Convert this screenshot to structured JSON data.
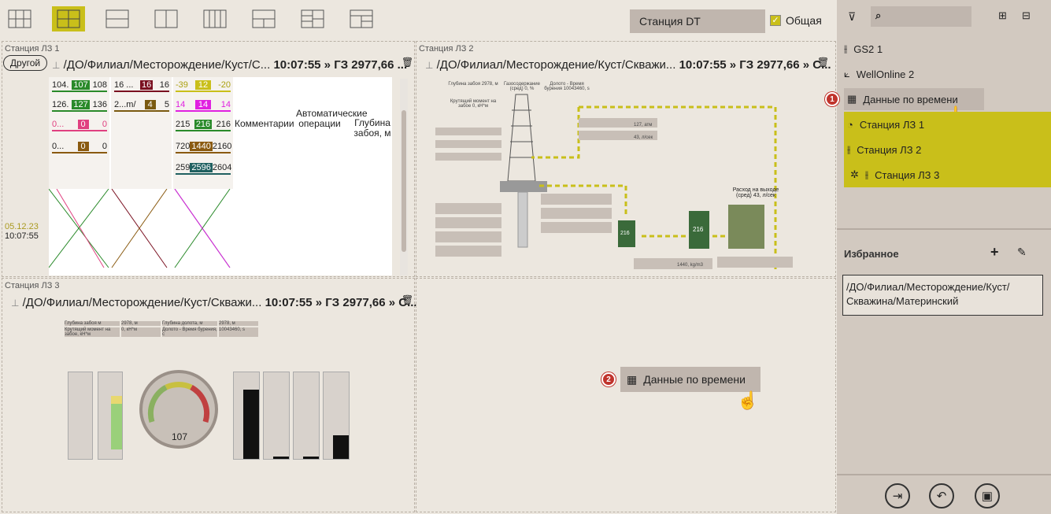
{
  "toolbar": {
    "layouts": [
      "grid-3x3",
      "grid-2x2",
      "split-horizontal",
      "split-vertical",
      "columns-4",
      "layout-1-2",
      "layout-2-1",
      "layout-rows"
    ],
    "active_layout": 1,
    "station_value": "Станция DT",
    "general_label": "Общая",
    "general_checked": true
  },
  "panels": {
    "p1": {
      "title": "Станция ЛЗ 1",
      "other_btn": "Другой",
      "path": "/ДО/Филиал/Месторождение/Куст/С...",
      "time": "10:07:55",
      "arrow": "»",
      "value": "ГЗ 2977,66 ...",
      "date": "05.12.23",
      "clock": "10:07:55",
      "col_comments": "Комментарии",
      "col_auto": "Автоматические операции",
      "col_depth": "Глубина забоя, м",
      "gauges": [
        [
          "104.",
          "107",
          "108",
          "#2a8a2a"
        ],
        [
          "126.",
          "127",
          "136",
          "#2a8a2a"
        ],
        [
          "0...",
          "0",
          "0",
          "#e04080"
        ],
        [
          "0...",
          "0",
          "0",
          "#8a5a10"
        ]
      ],
      "gauges2": [
        [
          "16 ...",
          "16",
          "16",
          "#7a1020"
        ],
        [
          "2...m/",
          "4",
          "5",
          "#7a5a10"
        ]
      ],
      "gauges3": [
        [
          "-39",
          "12",
          "-20",
          "#c9bf1a"
        ],
        [
          "14",
          "14",
          "14",
          "#e020e0"
        ],
        [
          "215",
          "216",
          "216",
          "#2a8a2a"
        ],
        [
          "720",
          "1440",
          "2160",
          "#8a5a10"
        ],
        [
          "259",
          "2596",
          "2604",
          "#206060"
        ]
      ]
    },
    "p2": {
      "title": "Станция ЛЗ 2",
      "path": "/ДО/Филиал/Месторождение/Куст/Скважи...",
      "time": "10:07:55",
      "arrow": "»",
      "value": "ГЗ 2977,66 » С...",
      "labels": {
        "depth": "Глубина забоя 2978, м",
        "gas": "Газосодержание (сред) 0, %",
        "bit": "Долото - Время бурения 10043460, s",
        "torque": "Крутящий момент на забое 0, кН*м",
        "pressure": "127, атм",
        "flow": "43, л/сек",
        "outflow": "Расход на выходе (сред) 43, л/сек",
        "volume": "1440, kg/m3"
      },
      "tanks": [
        "216",
        "216",
        "216"
      ]
    },
    "p3": {
      "title": "Станция ЛЗ 3",
      "path": "/ДО/Филиал/Месторождение/Куст/Скважи...",
      "time": "10:07:55",
      "arrow": "»",
      "value": "ГЗ 2977,66 » С...",
      "gauge_value": "107",
      "table": [
        [
          "Глубина забоя м",
          "2978, м",
          "Глубина долота, м",
          "2978, м"
        ],
        [
          "Крутящий момент на забое, кН*м",
          "0, кН*м",
          "Долото - Время бурения, с",
          "10043460, s"
        ]
      ]
    },
    "p4": {
      "drop_label": "Данные по времени",
      "badge": "2"
    }
  },
  "sidebar": {
    "items": [
      {
        "label": "GS2 1",
        "icon": "rig-icon"
      },
      {
        "label": "WellOnline 2",
        "icon": "well-icon"
      },
      {
        "label": "Данные по времени",
        "icon": "table-icon",
        "badge": "1"
      },
      {
        "label": "Станция ЛЗ 1",
        "icon": "clock-icon"
      },
      {
        "label": "Станция ЛЗ 2",
        "icon": "rig-icon"
      },
      {
        "label": "Станция ЛЗ 3",
        "icon": "rig-icon"
      }
    ],
    "favorites_title": "Избранное",
    "favorite_path": "/ДО/Филиал/Месторождение/Куст/Скважина/Материнский"
  },
  "colors": {
    "accent": "#c9bf1a",
    "sidebar": "#d2c9c0",
    "badge": "#c0342c"
  }
}
